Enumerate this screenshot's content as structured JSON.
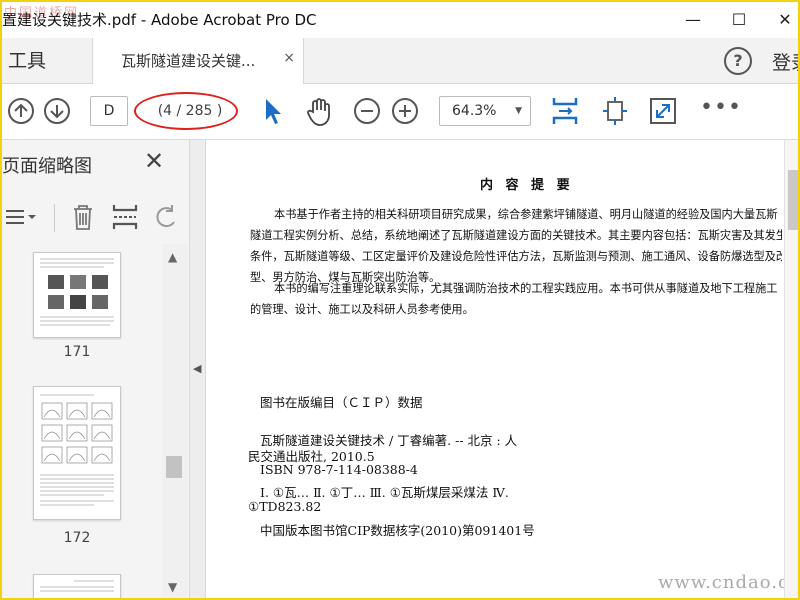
{
  "window": {
    "title": "置建设关键技术.pdf - Adobe Acrobat Pro DC",
    "watermark_top": "中国道桥网",
    "minimize": "—",
    "maximize": "☐",
    "close": "✕"
  },
  "tabs": {
    "tools_label": "工具",
    "doc_tab_label": "瓦斯隧道建设关键...",
    "doc_tab_close": "×",
    "help": "?",
    "login": "登录"
  },
  "toolbar": {
    "current_page": "D",
    "page_count": "(4 / 285 )",
    "zoom": "64.3%",
    "more": "•••"
  },
  "left_panel": {
    "title": "页面缩略图",
    "close": "✕",
    "thumbnails": [
      {
        "page": "171"
      },
      {
        "page": "172"
      }
    ]
  },
  "document": {
    "heading": "内 容 提 要",
    "paragraph1_lines": [
      "本书基于作者主持的相关科研项目研究成果，综合参建紫坪铺隧道、明月山隧道的经验及国内大量瓦斯",
      "隧道工程实例分析、总结，系统地阐述了瓦斯隧道建设方面的关键技术。其主要内容包括：瓦斯灾害及其发生",
      "条件，瓦斯隧道等级、工区定量评价及建设危险性评估方法，瓦斯监测与预测、施工通风、设备防爆选型及改",
      "型、男方防治、煤与瓦斯突出防治等。"
    ],
    "paragraph2_lines": [
      "本书的编写注重理论联系实际，尤其强调防治技术的工程实践应用。本书可供从事隧道及地下工程施工",
      "的管理、设计、施工以及科研人员参考使用。"
    ],
    "cip_title": "图书在版编目（ＣＩＰ）数据",
    "cip_line1": "瓦斯隧道建设关键技术 / 丁睿编著. -- 北京 : 人",
    "cip_line2": "民交通出版社, 2010.5",
    "cip_line3": "ISBN 978-7-114-08388-4",
    "cip_line4": "Ⅰ. ①瓦…  Ⅱ. ①丁…  Ⅲ. ①瓦斯煤层采煤法  Ⅳ.",
    "cip_line5": "①TD823.82",
    "cip_line6": "中国版本图书馆CIP数据核字(2010)第091401号",
    "site_watermark": "www.cndao.com"
  },
  "colors": {
    "accent_blue": "#1a6fc4",
    "highlight_red": "#e0201c",
    "frame_yellow": "#f2d20c"
  }
}
